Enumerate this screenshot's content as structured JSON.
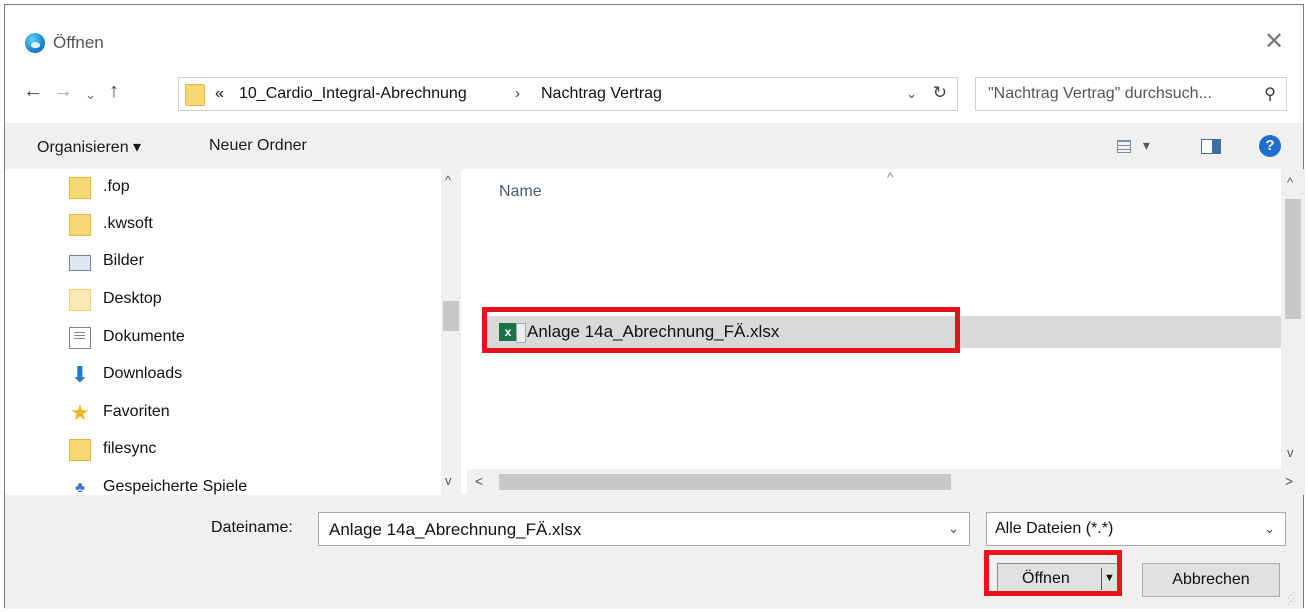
{
  "window": {
    "title": "Öffnen",
    "close_glyph": "✕"
  },
  "nav": {
    "back": "←",
    "forward": "→",
    "recent": "⌄",
    "up": "↑",
    "breadcrumb_overflow": "«",
    "path": [
      "10_Cardio_Integral-Abrechnung",
      "Nachtrag Vertrag"
    ],
    "separator": "›",
    "dropdown": "⌄",
    "refresh": "↻",
    "search_placeholder": "\"Nachtrag Vertrag\" durchsuch...",
    "search_icon": "⚲"
  },
  "toolbar": {
    "organize": "Organisieren ▾",
    "new_folder": "Neuer Ordner",
    "view_dropdown": "▾",
    "help": "?"
  },
  "sidebar": {
    "items": [
      {
        "label": ".fop",
        "icon": "folder-icon"
      },
      {
        "label": ".kwsoft",
        "icon": "folder-icon"
      },
      {
        "label": "Bilder",
        "icon": "pictures-icon"
      },
      {
        "label": "Desktop",
        "icon": "desktop-folder-icon"
      },
      {
        "label": "Dokumente",
        "icon": "documents-icon"
      },
      {
        "label": "Downloads",
        "icon": "download-icon"
      },
      {
        "label": "Favoriten",
        "icon": "star-icon"
      },
      {
        "label": "filesync",
        "icon": "folder-icon"
      },
      {
        "label": "Gespeicherte Spiele",
        "icon": "games-icon"
      }
    ],
    "scroll_up": "^",
    "scroll_down": "v"
  },
  "file_list": {
    "sort_indicator": "^",
    "column_name": "Name",
    "files": [
      {
        "name": "Anlage 14a_Abrechnung_FÄ.xlsx",
        "icon": "excel-file-icon",
        "selected": true
      }
    ],
    "scroll_up": "^",
    "scroll_down": "v",
    "scroll_left": "<",
    "scroll_right": ">"
  },
  "bottom": {
    "filename_label": "Dateiname:",
    "filename_value": "Anlage 14a_Abrechnung_FÄ.xlsx",
    "filename_dropdown": "⌄",
    "file_type": "Alle Dateien (*.*)",
    "file_type_dropdown": "⌄",
    "open_button": "Öffnen",
    "open_arrow": "▼",
    "cancel_button": "Abbrechen"
  },
  "colors": {
    "highlight": "#e8141c",
    "selection": "#d9d9d9",
    "toolbar_bg": "#f0f0f0"
  }
}
